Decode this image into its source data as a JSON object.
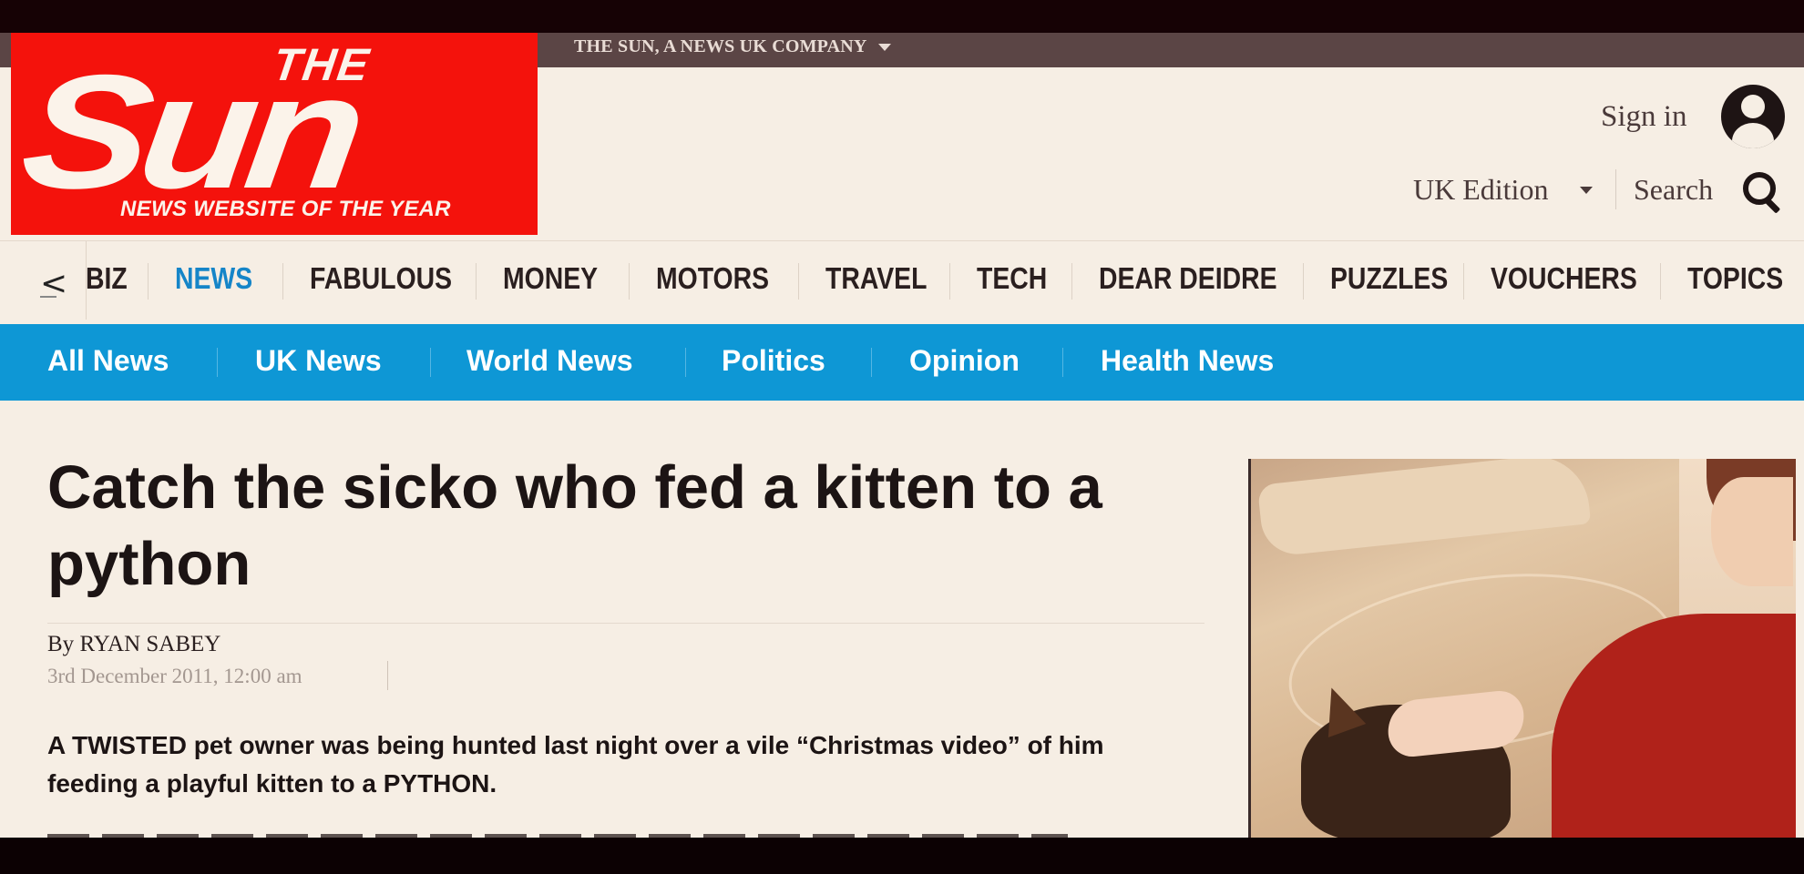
{
  "corporate": {
    "text": "THE SUN, A NEWS UK COMPANY"
  },
  "logo": {
    "the": "THE",
    "sun": "Sun",
    "tagline": "NEWS WEBSITE OF THE YEAR"
  },
  "header": {
    "sign_in": "Sign in",
    "edition": "UK Edition",
    "search": "Search"
  },
  "nav": {
    "back_glyph": "<",
    "items": [
      {
        "label": "BIZ",
        "active": false
      },
      {
        "label": "NEWS",
        "active": true
      },
      {
        "label": "FABULOUS",
        "active": false
      },
      {
        "label": "MONEY",
        "active": false
      },
      {
        "label": "MOTORS",
        "active": false
      },
      {
        "label": "TRAVEL",
        "active": false
      },
      {
        "label": "TECH",
        "active": false
      },
      {
        "label": "DEAR DEIDRE",
        "active": false
      },
      {
        "label": "PUZZLES",
        "active": false
      },
      {
        "label": "VOUCHERS",
        "active": false
      },
      {
        "label": "TOPICS",
        "active": false
      }
    ]
  },
  "subnav": {
    "items": [
      "All News",
      "UK News",
      "World News",
      "Politics",
      "Opinion",
      "Health News"
    ]
  },
  "article": {
    "headline": "Catch the sicko who fed a kitten to a python",
    "byline_prefix": "By ",
    "author": "RYAN SABEY",
    "date": "3rd December 2011, 12:00 am",
    "standfirst": "A TWISTED pet owner was being hunted last night over a vile “Christmas video” of him feeding a playful kitten to a PYTHON."
  },
  "colors": {
    "brand_red": "#f4120c",
    "nav_active_blue": "#1585c8",
    "subnav_blue": "#0e97d5",
    "page_bg": "#f6eee4"
  }
}
